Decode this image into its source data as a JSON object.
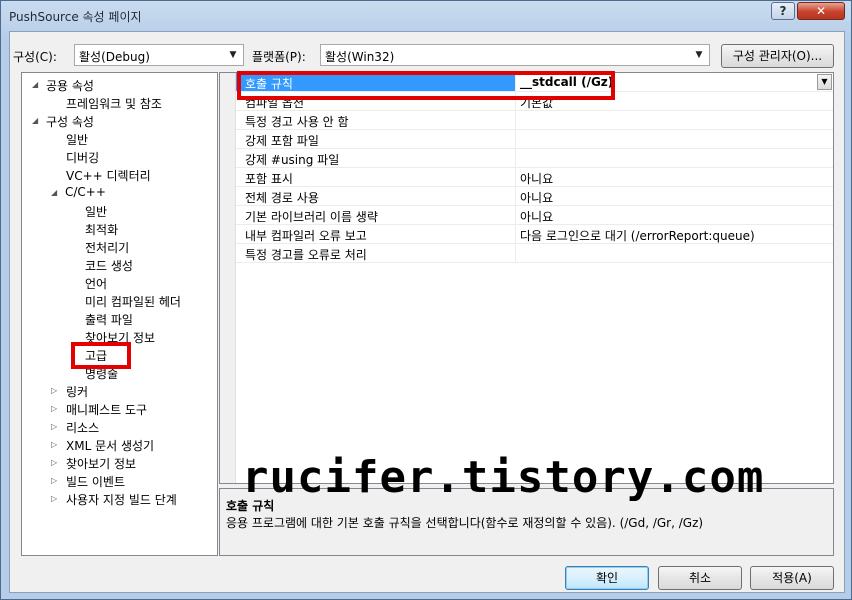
{
  "window": {
    "title": "PushSource 속성 페이지",
    "help_label": "?",
    "close_label": "✕"
  },
  "config": {
    "label": "구성(C):",
    "value": "활성(Debug)"
  },
  "platform": {
    "label": "플랫폼(P):",
    "value": "활성(Win32)"
  },
  "config_manager_label": "구성 관리자(O)...",
  "tree": [
    {
      "label": "공용 속성",
      "toggle": "◢"
    },
    {
      "label": "프레임워크 및 참조",
      "toggle": ""
    },
    {
      "label": "구성 속성",
      "toggle": "◢"
    },
    {
      "label": "일반",
      "toggle": ""
    },
    {
      "label": "디버깅",
      "toggle": ""
    },
    {
      "label": "VC++ 디렉터리",
      "toggle": ""
    },
    {
      "label": "C/C++",
      "toggle": "◢"
    },
    {
      "label": "일반",
      "toggle": ""
    },
    {
      "label": "최적화",
      "toggle": ""
    },
    {
      "label": "전처리기",
      "toggle": ""
    },
    {
      "label": "코드 생성",
      "toggle": ""
    },
    {
      "label": "언어",
      "toggle": ""
    },
    {
      "label": "미리 컴파일된 헤더",
      "toggle": ""
    },
    {
      "label": "출력 파일",
      "toggle": ""
    },
    {
      "label": "찾아보기 정보",
      "toggle": ""
    },
    {
      "label": "고급",
      "toggle": ""
    },
    {
      "label": "명령줄",
      "toggle": ""
    },
    {
      "label": "링커",
      "toggle": "▷"
    },
    {
      "label": "매니페스트 도구",
      "toggle": "▷"
    },
    {
      "label": "리소스",
      "toggle": "▷"
    },
    {
      "label": "XML 문서 생성기",
      "toggle": "▷"
    },
    {
      "label": "찾아보기 정보",
      "toggle": "▷"
    },
    {
      "label": "빌드 이벤트",
      "toggle": "▷"
    },
    {
      "label": "사용자 지정 빌드 단계",
      "toggle": "▷"
    }
  ],
  "properties": [
    {
      "name": "호출 규칙",
      "value": "__stdcall (/Gz)"
    },
    {
      "name": "컴파일 옵션",
      "value": "기본값"
    },
    {
      "name": "특정 경고 사용 안 함",
      "value": ""
    },
    {
      "name": "강제 포함 파일",
      "value": ""
    },
    {
      "name": "강제 #using 파일",
      "value": ""
    },
    {
      "name": "포함 표시",
      "value": "아니요"
    },
    {
      "name": "전체 경로 사용",
      "value": "아니요"
    },
    {
      "name": "기본 라이브러리 이름 생략",
      "value": "아니요"
    },
    {
      "name": "내부 컴파일러 오류 보고",
      "value": "다음 로그인으로 대기 (/errorReport:queue)"
    },
    {
      "name": "특정 경고를 오류로 처리",
      "value": ""
    }
  ],
  "dropdown_glyph": "▼",
  "combo_glyph": "▼",
  "description": {
    "title": "호출 규칙",
    "text": "응용 프로그램에 대한 기본 호출 규칙을 선택합니다(함수로 재정의할 수 있음).     (/Gd, /Gr, /Gz)"
  },
  "watermark": "rucifer.tistory.com",
  "buttons": {
    "ok": "확인",
    "cancel": "취소",
    "apply": "적용(A)"
  },
  "colors": {
    "highlight": "#e30000",
    "selection": "#3399ff"
  }
}
